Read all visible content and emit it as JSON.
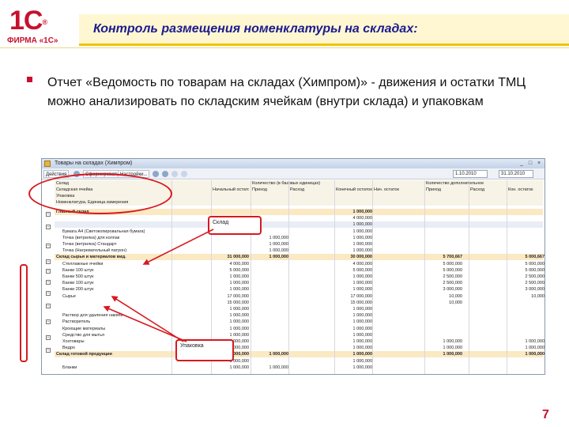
{
  "logo": {
    "mark": "1С",
    "sup": "®",
    "firm": "ФИРМА «1С»"
  },
  "title": "Контроль размещения номенклатуры на складах:",
  "bullet": "Отчет «Ведомость по товарам на складах (Химпром)» - движения и остатки ТМЦ можно анализировать по складским ячейкам (внутри склада) и упаковкам",
  "window": {
    "title": "Товары на складах (Химпром)",
    "toolbar": {
      "actions": "Действия",
      "generate": "Сформировать",
      "settings": "Настройки...",
      "date_from": "1.10.2010",
      "date_to": "31.10.2010"
    },
    "header": {
      "left1": "Склад",
      "left2": "Складская ячейка",
      "left3": "Упаковка",
      "left4": "Номенклатура, Единица измерения",
      "group1": "Количество (в базовых единицах)",
      "group2": "Количество дополнительное",
      "cols": [
        "Начальный остаток",
        "Приход",
        "Расход",
        "Конечный остаток",
        "Нач. остаток",
        "Приход",
        "Расход",
        "Кон. остаток"
      ]
    },
    "rows": [
      {
        "name": "Главный склад",
        "v": [
          "",
          "",
          "",
          "1 000,000",
          "",
          "",
          "",
          ""
        ],
        "kind": "grp"
      },
      {
        "name": "",
        "v": [
          "",
          "",
          "",
          "4 000,000",
          "",
          "",
          "",
          ""
        ],
        "kind": ""
      },
      {
        "name": "",
        "v": [
          "",
          "",
          "",
          "1 000,000",
          "",
          "",
          "",
          ""
        ],
        "kind": "sel"
      },
      {
        "name": "Бумага А4 (Светокопировальная бумага)",
        "v": [
          "",
          "",
          "",
          "1 000,000",
          "",
          "",
          "",
          ""
        ],
        "kind": ""
      },
      {
        "name": "Точка (ветрилка) для колпак",
        "v": [
          "",
          "1 000,000",
          "",
          "1 000,000",
          "",
          "",
          "",
          ""
        ],
        "kind": ""
      },
      {
        "name": "Точка (ветрилка) Стандарт",
        "v": [
          "",
          "1 000,000",
          "",
          "1 000,000",
          "",
          "",
          "",
          ""
        ],
        "kind": ""
      },
      {
        "name": "Точка (Нагревательный патрон)",
        "v": [
          "",
          "1 000,000",
          "",
          "1 000,000",
          "",
          "",
          "",
          ""
        ],
        "kind": ""
      },
      {
        "name": "Склад сырья и материалов вид.",
        "v": [
          "31 000,000",
          "1 000,000",
          "",
          "30 000,000",
          "",
          "5 700,667",
          "",
          "5 000,667"
        ],
        "kind": "grp"
      },
      {
        "name": "Стеллажные ячейки",
        "v": [
          "4 000,000",
          "",
          "",
          "4 000,000",
          "",
          "5 000,000",
          "",
          "5 000,000"
        ],
        "kind": ""
      },
      {
        "name": "Банки 100 штук",
        "v": [
          "5 000,000",
          "",
          "",
          "5 000,000",
          "",
          "5 000,000",
          "",
          "5 000,000"
        ],
        "kind": ""
      },
      {
        "name": "Банки 500 штук",
        "v": [
          "1 000,000",
          "",
          "",
          "1 000,000",
          "",
          "2 500,000",
          "",
          "2 500,000"
        ],
        "kind": ""
      },
      {
        "name": "Банки 100 штук",
        "v": [
          "1 000,000",
          "",
          "",
          "1 000,000",
          "",
          "2 500,000",
          "",
          "2 500,000"
        ],
        "kind": ""
      },
      {
        "name": "Банки 200 штук",
        "v": [
          "1 000,000",
          "",
          "",
          "1 000,000",
          "",
          "3 000,000",
          "",
          "3 000,000"
        ],
        "kind": ""
      },
      {
        "name": "Сырье",
        "v": [
          "17 000,000",
          "",
          "",
          "17 000,000",
          "",
          "10,000",
          "",
          "10,000"
        ],
        "kind": ""
      },
      {
        "name": "",
        "v": [
          "15 000,000",
          "",
          "",
          "15 000,000",
          "",
          "10,000",
          "",
          ""
        ],
        "kind": ""
      },
      {
        "name": "",
        "v": [
          "1 000,000",
          "",
          "",
          "1 000,000",
          "",
          "",
          "",
          ""
        ],
        "kind": ""
      },
      {
        "name": "Раствор для удаления накипи",
        "v": [
          "1 000,000",
          "",
          "",
          "1 000,000",
          "",
          "",
          "",
          ""
        ],
        "kind": ""
      },
      {
        "name": "Растворитель",
        "v": [
          "1 000,000",
          "",
          "",
          "1 000,000",
          "",
          "",
          "",
          ""
        ],
        "kind": ""
      },
      {
        "name": "Кроющие материалы",
        "v": [
          "1 000,000",
          "",
          "",
          "1 000,000",
          "",
          "",
          "",
          ""
        ],
        "kind": ""
      },
      {
        "name": "Средство для мытья",
        "v": [
          "1 000,000",
          "",
          "",
          "1 000,000",
          "",
          "",
          "",
          ""
        ],
        "kind": ""
      },
      {
        "name": "Хозтовары",
        "v": [
          "1 000,000",
          "",
          "",
          "1 000,000",
          "",
          "1 000,000",
          "",
          "1 000,000"
        ],
        "kind": ""
      },
      {
        "name": "Ведро",
        "v": [
          "1 000,000",
          "",
          "",
          "1 000,000",
          "",
          "1 000,000",
          "",
          "1 000,000"
        ],
        "kind": ""
      },
      {
        "name": "Склад готовой продукции",
        "v": [
          "1 000,000",
          "1 000,000",
          "",
          "1 000,000",
          "",
          "1 000,000",
          "",
          "1 000,000"
        ],
        "kind": "grp"
      },
      {
        "name": "",
        "v": [
          "1 000,000",
          "",
          "",
          "1 000,000",
          "",
          "",
          "",
          ""
        ],
        "kind": ""
      },
      {
        "name": "Бланки",
        "v": [
          "1 000,000",
          "1 000,000",
          "",
          "1 000,000",
          "",
          "",
          "",
          ""
        ],
        "kind": ""
      }
    ]
  },
  "callouts": {
    "sklad": "Склад",
    "upakovka": "Упаковка"
  },
  "page_number": "7",
  "colors": {
    "brand_red": "#c8102e",
    "title_blue": "#1b1b8f",
    "annotation_red": "#d71920"
  }
}
